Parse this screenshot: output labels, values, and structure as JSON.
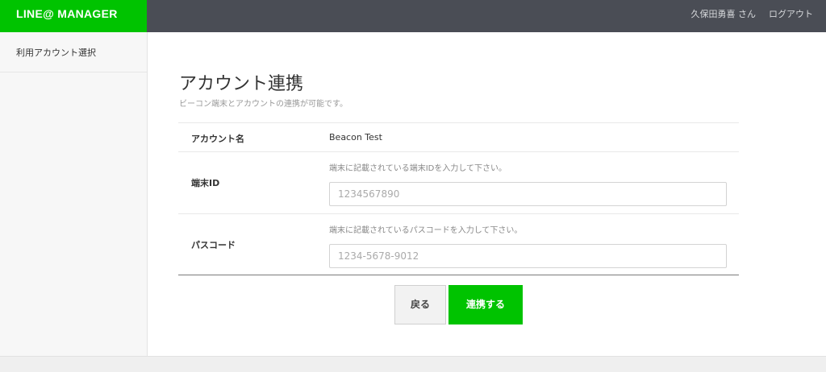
{
  "header": {
    "logo": "LINE@ MANAGER",
    "user": "久保田勇喜 さん",
    "logout": "ログアウト"
  },
  "sidebar": {
    "items": [
      {
        "label": "利用アカウント選択"
      }
    ]
  },
  "main": {
    "title": "アカウント連携",
    "description": "ビーコン端末とアカウントの連携が可能です。",
    "form": {
      "account_name_label": "アカウント名",
      "account_name_value": "Beacon Test",
      "device_id_label": "端末ID",
      "device_id_hint": "端末に記載されている端末IDを入力して下さい。",
      "device_id_placeholder": "1234567890",
      "device_id_value": "",
      "passcode_label": "パスコード",
      "passcode_hint": "端末に記載されているパスコードを入力して下さい。",
      "passcode_placeholder": "1234-5678-9012",
      "passcode_value": ""
    },
    "buttons": {
      "back": "戻る",
      "link": "連携する"
    }
  },
  "colors": {
    "brand_green": "#00c300",
    "topbar": "#4a4d55"
  }
}
